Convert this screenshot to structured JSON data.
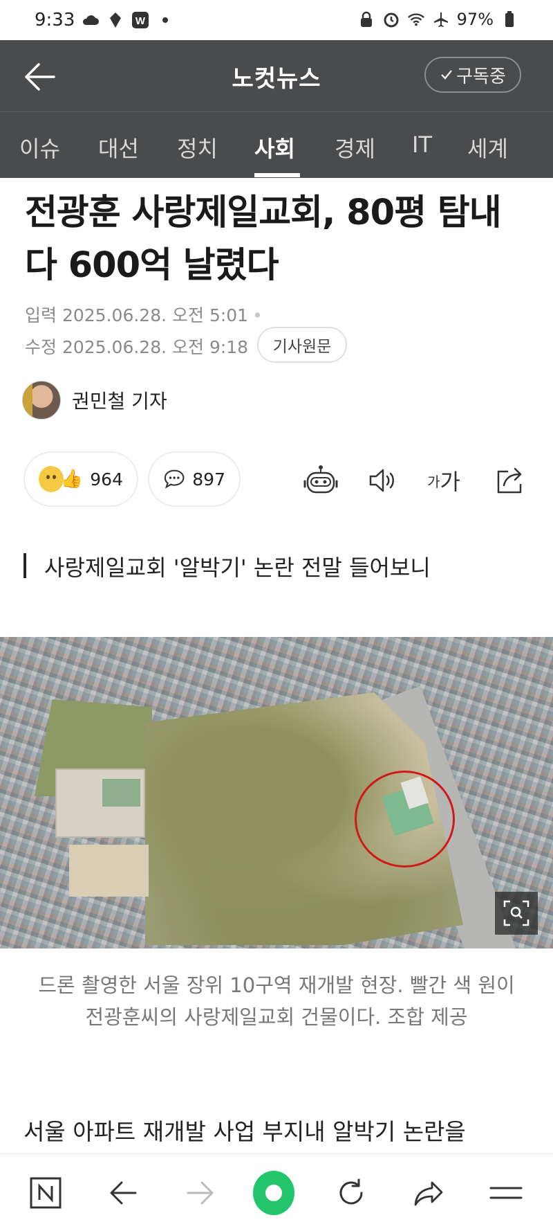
{
  "status_bar": {
    "time": "9:33",
    "battery": "97%",
    "left_icons": [
      "cloud-icon",
      "location-icon",
      "w-app-icon",
      "dot-icon"
    ],
    "right_icons": [
      "lock-icon",
      "alarm-icon",
      "wifi-icon",
      "airplane-icon",
      "battery-icon"
    ]
  },
  "header": {
    "title": "노컷뉴스",
    "subscribe_label": "구독중"
  },
  "tabs": [
    {
      "label": "이슈",
      "active": false
    },
    {
      "label": "대선",
      "active": false
    },
    {
      "label": "정치",
      "active": false
    },
    {
      "label": "사회",
      "active": true
    },
    {
      "label": "경제",
      "active": false
    },
    {
      "label": "IT",
      "active": false
    },
    {
      "label": "세계",
      "active": false
    }
  ],
  "article": {
    "headline": "전광훈 사랑제일교회, 80평 탐내다 600억 날렸다",
    "input_label": "입력",
    "input_date": "2025.06.28. 오전 5:01",
    "edit_label": "수정",
    "edit_date": "2025.06.28. 오전 9:18",
    "original_button": "기사원문",
    "author": "권민철 기자",
    "reaction_count": "964",
    "comment_count": "897",
    "subheading": "사랑제일교회 '알박기' 논란 전말 들어보니",
    "caption": "드론 촬영한 서울 장위 10구역 재개발 현장. 빨간 색 원이 전광훈씨의 사랑제일교회 건물이다. 조합 제공",
    "body_start": "서울 아파트 재개발 사업 부지내 알박기 논란을"
  },
  "colors": {
    "header_bg": "#4a4b4d",
    "accent_green": "#22c56a",
    "circle_red": "#d0181b"
  }
}
